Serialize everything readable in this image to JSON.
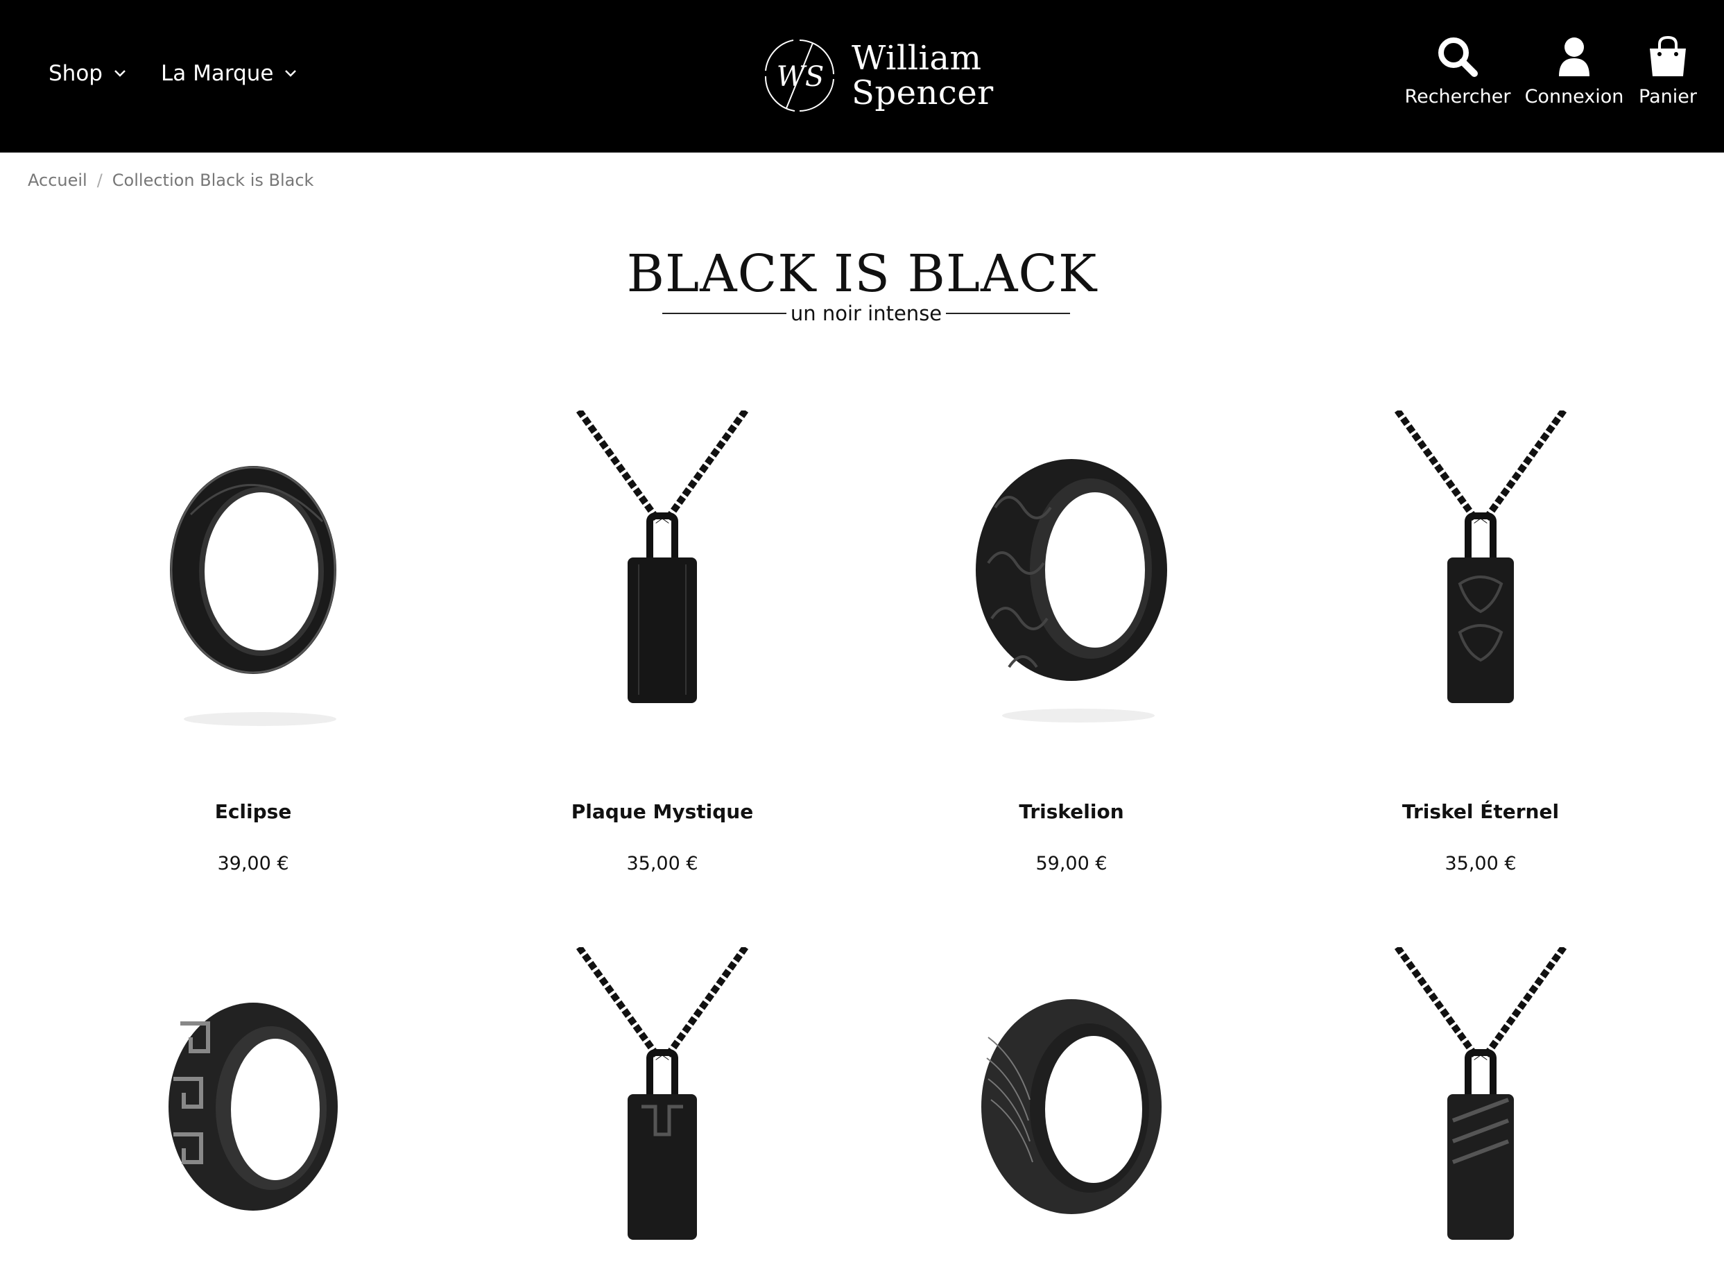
{
  "header": {
    "nav": [
      {
        "label": "Shop",
        "icon": "chevron-down-icon"
      },
      {
        "label": "La Marque",
        "icon": "chevron-down-icon"
      }
    ],
    "logo": {
      "monogram": "WS",
      "line1": "William",
      "line2": "Spencer"
    },
    "tools": [
      {
        "label": "Rechercher",
        "icon": "search-icon"
      },
      {
        "label": "Connexion",
        "icon": "user-icon"
      },
      {
        "label": "Panier",
        "icon": "shopping-bag-icon"
      }
    ]
  },
  "breadcrumb": {
    "home": "Accueil",
    "separator": "/",
    "current": "Collection Black is Black"
  },
  "collection": {
    "title": "BLACK IS BLACK",
    "subtitle": "un noir intense"
  },
  "products": [
    {
      "name": "Eclipse",
      "price": "39,00 €",
      "image": "plain-black-ring"
    },
    {
      "name": "Plaque Mystique",
      "price": "35,00 €",
      "image": "black-plate-pendant"
    },
    {
      "name": "Triskelion",
      "price": "59,00 €",
      "image": "engraved-triskel-ring"
    },
    {
      "name": "Triskel Éternel",
      "price": "35,00 €",
      "image": "triskel-plate-pendant"
    }
  ],
  "products_row2": [
    {
      "image": "greek-key-ring"
    },
    {
      "image": "greek-key-pendant"
    },
    {
      "image": "damascus-ring"
    },
    {
      "image": "striped-pendant"
    }
  ],
  "colors": {
    "header_bg": "#000000",
    "accent": "#111111",
    "muted": "#777777"
  }
}
